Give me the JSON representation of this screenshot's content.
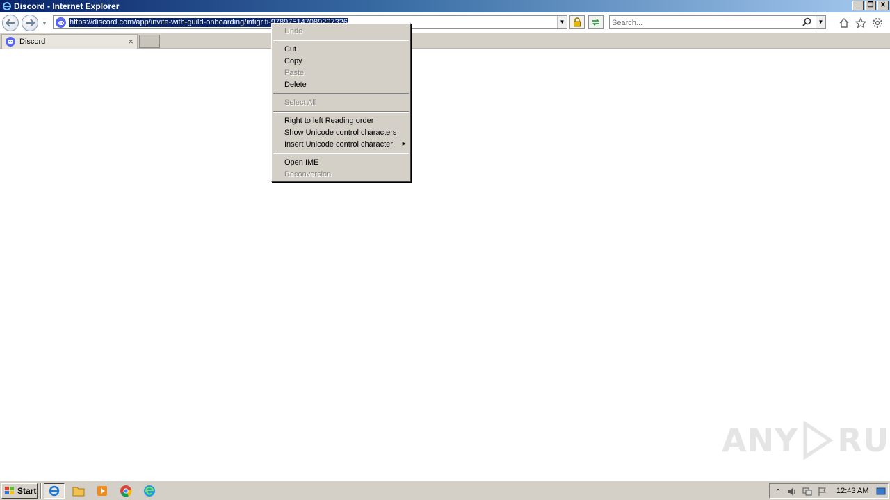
{
  "window": {
    "title": "Discord - Internet Explorer"
  },
  "navbar": {
    "url": "https://discord.com/app/invite-with-guild-onboarding/intigriti-978975147089297326",
    "search_placeholder": "Search..."
  },
  "tabs": [
    {
      "label": "Discord"
    }
  ],
  "context_menu": {
    "items": {
      "undo": "Undo",
      "cut": "Cut",
      "copy": "Copy",
      "paste": "Paste",
      "delete": "Delete",
      "select_all": "Select All",
      "rtl": "Right to left Reading order",
      "show_unicode": "Show Unicode control characters",
      "insert_unicode": "Insert Unicode control character",
      "open_ime": "Open IME",
      "reconversion": "Reconversion"
    }
  },
  "watermark": {
    "text_left": "ANY",
    "text_right": "RUN"
  },
  "taskbar": {
    "start_label": "Start",
    "clock": "12:43 AM"
  },
  "colors": {
    "discord_blurple": "#5865f2",
    "selection": "#0a246a",
    "menu_bg": "#d4d0c8"
  }
}
